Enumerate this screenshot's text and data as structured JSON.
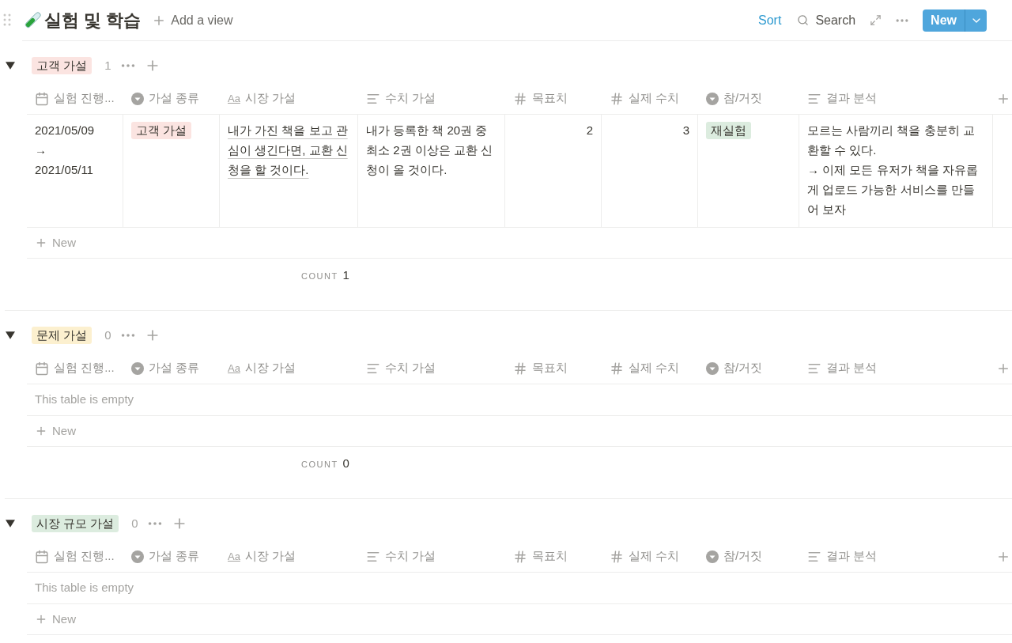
{
  "header": {
    "title": "실험 및 학습",
    "add_view": "Add a view",
    "sort": "Sort",
    "search": "Search",
    "new_button": "New"
  },
  "groups": [
    {
      "label": "고객 가설",
      "color": "#fbe4e1",
      "count": "1",
      "expanded": true,
      "columns": [
        {
          "kind": "date",
          "label": "실험 진행..."
        },
        {
          "kind": "select",
          "label": "가설 종류"
        },
        {
          "kind": "title",
          "icon": "Aa",
          "label": "시장 가설"
        },
        {
          "kind": "text",
          "label": "수치 가설"
        },
        {
          "kind": "number",
          "label": "목표치"
        },
        {
          "kind": "number",
          "label": "실제 수치"
        },
        {
          "kind": "select",
          "label": "참/거짓"
        },
        {
          "kind": "text",
          "label": "결과 분석"
        }
      ],
      "rows": [
        {
          "cells": [
            "2021/05/09\n→\n2021/05/11",
            {
              "tag": "고객 가설",
              "color": "#fbe4e1"
            },
            "내가 가진 책을 보고 관심이 생긴다면, 교환 신청을 할 것이다.",
            "내가 등록한 책 20권 중 최소 2권 이상은 교환 신청이 올 것이다.",
            "2",
            "3",
            {
              "tag": "재실험",
              "color": "#dcecdf"
            },
            "모르는 사람끼리 책을 충분히 교환할 수 있다.\n→ 이제 모든 유저가 책을 자유롭게 업로드 가능한 서비스를 만들어 보자"
          ]
        }
      ],
      "new_label": "New",
      "footer_label": "COUNT",
      "footer_value": "1"
    },
    {
      "label": "문제 가설",
      "color": "#fcf0cf",
      "count": "0",
      "expanded": true,
      "columns": [
        {
          "kind": "date",
          "label": "실험 진행..."
        },
        {
          "kind": "select",
          "label": "가설 종류"
        },
        {
          "kind": "title",
          "icon": "Aa",
          "label": "시장 가설"
        },
        {
          "kind": "text",
          "label": "수치 가설"
        },
        {
          "kind": "number",
          "label": "목표치"
        },
        {
          "kind": "number",
          "label": "실제 수치"
        },
        {
          "kind": "select",
          "label": "참/거짓"
        },
        {
          "kind": "text",
          "label": "결과 분석"
        }
      ],
      "empty_text": "This table is empty",
      "new_label": "New",
      "footer_label": "COUNT",
      "footer_value": "0"
    },
    {
      "label": "시장 규모 가설",
      "color": "#dcecdf",
      "count": "0",
      "expanded": true,
      "columns": [
        {
          "kind": "date",
          "label": "실험 진행..."
        },
        {
          "kind": "select",
          "label": "가설 종류"
        },
        {
          "kind": "title",
          "icon": "Aa",
          "label": "시장 가설"
        },
        {
          "kind": "text",
          "label": "수치 가설"
        },
        {
          "kind": "number",
          "label": "목표치"
        },
        {
          "kind": "number",
          "label": "실제 수치"
        },
        {
          "kind": "select",
          "label": "참/거짓"
        },
        {
          "kind": "text",
          "label": "결과 분석"
        }
      ],
      "empty_text": "This table is empty",
      "new_label": "New"
    }
  ]
}
